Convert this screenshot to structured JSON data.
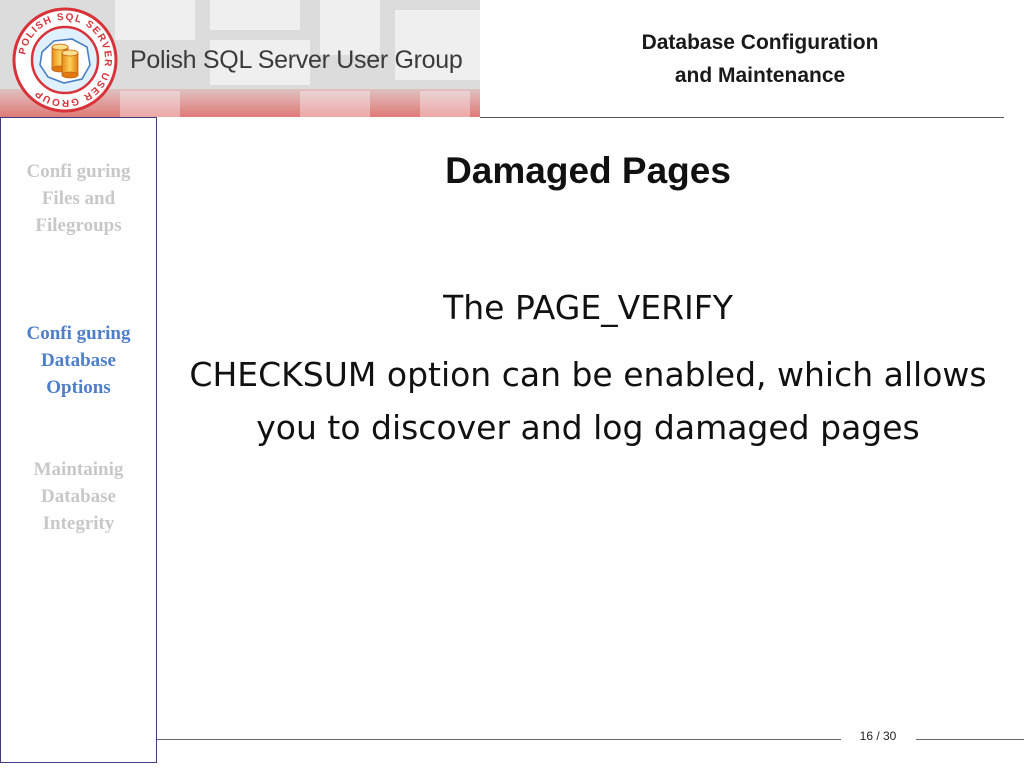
{
  "header": {
    "logo_ring_text": "POLISH SQL SERVER USER GROUP",
    "group_name": "Polish SQL Server User Group",
    "deck_title_line1": "Database Configuration",
    "deck_title_line2": "and Maintenance",
    "brand_color": "#d9333a"
  },
  "sidebar": {
    "items": [
      {
        "lines": [
          "Confi guring",
          "Files and",
          "Filegroups"
        ],
        "state": "inactive"
      },
      {
        "lines": [
          "Confi guring",
          "Database",
          "Options"
        ],
        "state": "active"
      },
      {
        "lines": [
          "Maintainig",
          "Database",
          "Integrity"
        ],
        "state": "inactive"
      }
    ],
    "active_color": "#4f7fc8",
    "inactive_color": "#c8c8c8"
  },
  "slide": {
    "title": "Damaged Pages",
    "body_line1": "The PAGE_VERIFY",
    "body_line2": "CHECKSUM option can be enabled, which allows you to discover and log damaged pages"
  },
  "footer": {
    "page_indicator": "16 / 30",
    "current_page": 16,
    "total_pages": 30
  }
}
